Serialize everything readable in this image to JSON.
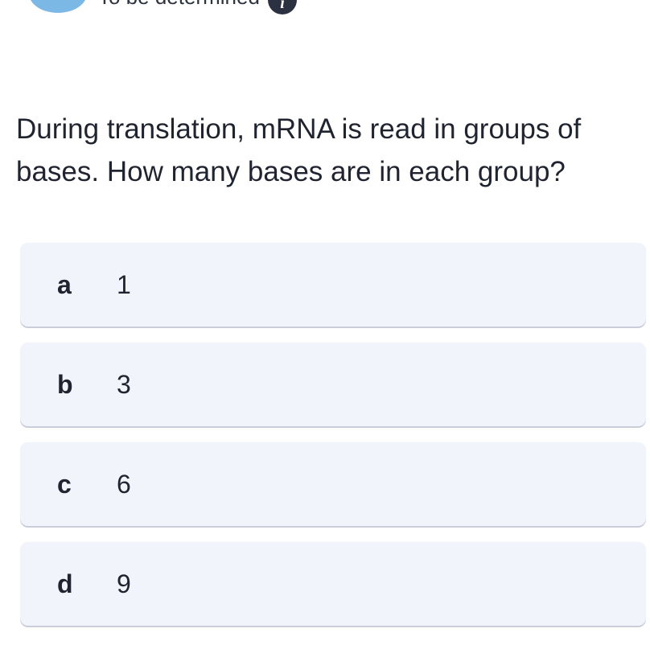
{
  "header": {
    "status_text": "To be determined",
    "info_icon": "info-icon",
    "info_glyph": "i",
    "status_color": "#7cb8e6"
  },
  "question": {
    "text": "During translation, mRNA is read in groups of bases. How many bases are in each group?"
  },
  "options": [
    {
      "letter": "a",
      "value": "1"
    },
    {
      "letter": "b",
      "value": "3"
    },
    {
      "letter": "c",
      "value": "6"
    },
    {
      "letter": "d",
      "value": "9"
    }
  ],
  "colors": {
    "option_background": "#f1f4fa",
    "text": "#1f2430"
  }
}
